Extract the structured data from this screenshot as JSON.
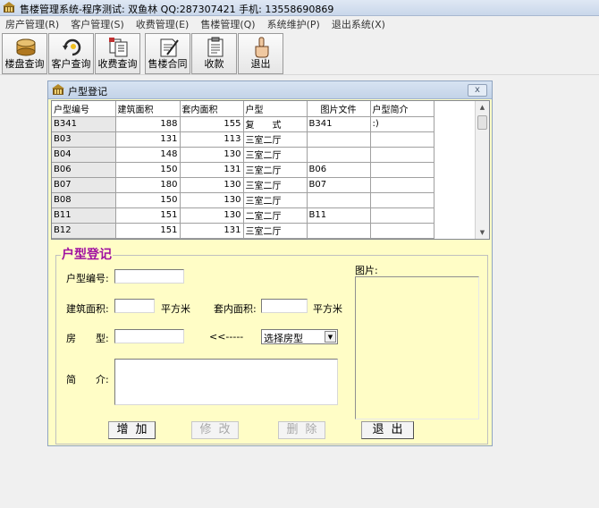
{
  "window": {
    "title": "售楼管理系统-程序测试: 双鱼林 QQ:287307421 手机: 13558690869"
  },
  "menu": [
    {
      "label": "房产管理(R)"
    },
    {
      "label": "客户管理(S)"
    },
    {
      "label": "收费管理(E)"
    },
    {
      "label": "售楼管理(Q)"
    },
    {
      "label": "系统维护(P)"
    },
    {
      "label": "退出系统(X)"
    }
  ],
  "toolbar": [
    {
      "label": "楼盘查询",
      "icon": "database-disk-icon"
    },
    {
      "label": "客户查询",
      "icon": "search-refresh-icon"
    },
    {
      "label": "收费查询",
      "icon": "documents-icon"
    },
    {
      "label": "售楼合同",
      "icon": "contract-pen-icon"
    },
    {
      "label": "收款",
      "icon": "clipboard-icon"
    },
    {
      "label": "退出",
      "icon": "hand-exit-icon"
    }
  ],
  "dialog": {
    "title": "户型登记",
    "close_label": "x"
  },
  "grid": {
    "columns": [
      "户型编号",
      "建筑面积",
      "套内面积",
      "户型",
      "图片文件",
      "户型简介"
    ],
    "rows": [
      [
        "B341",
        "188",
        "155",
        "复　　式",
        "B341",
        ":)"
      ],
      [
        "B03",
        "131",
        "113",
        "三室二厅",
        "",
        ""
      ],
      [
        "B04",
        "148",
        "130",
        "三室二厅",
        "",
        ""
      ],
      [
        "B06",
        "150",
        "131",
        "三室二厅",
        "B06",
        ""
      ],
      [
        "B07",
        "180",
        "130",
        "三室二厅",
        "B07",
        ""
      ],
      [
        "B08",
        "150",
        "130",
        "三室二厅",
        "",
        ""
      ],
      [
        "B11",
        "151",
        "130",
        "二室二厅",
        "B11",
        ""
      ],
      [
        "B12",
        "151",
        "131",
        "三室二厅",
        "",
        ""
      ]
    ]
  },
  "form": {
    "group_title": "户型登记",
    "code_label": "户型编号:",
    "code_value": "",
    "area_label": "建筑面积:",
    "area_value": "",
    "area_unit": "平方米",
    "inner_area_label": "套内面积:",
    "inner_area_value": "",
    "inner_area_unit": "平方米",
    "type_label": "房　　型:",
    "type_value": "",
    "arrow_hint": "<<-----",
    "type_select_value": "选择房型",
    "intro_label": "简　　介:",
    "intro_value": "",
    "photo_label": "图片:"
  },
  "buttons": {
    "add": "增加",
    "edit": "修改",
    "delete": "删除",
    "exit": "退出"
  }
}
